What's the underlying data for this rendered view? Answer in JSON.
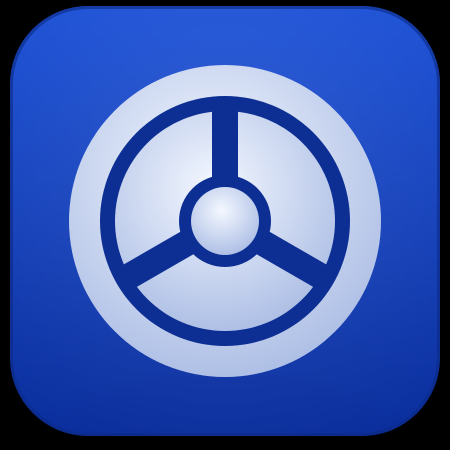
{
  "icon": {
    "name": "dial-icon",
    "colors": {
      "tile_top": "#1a4fd6",
      "tile_bottom": "#0a2e9c",
      "tile_edge": "#0b2a86",
      "ring": "#dde6f6",
      "ring_shadow": "#9fb3e0",
      "inner_dark": "#0d2f94"
    }
  }
}
